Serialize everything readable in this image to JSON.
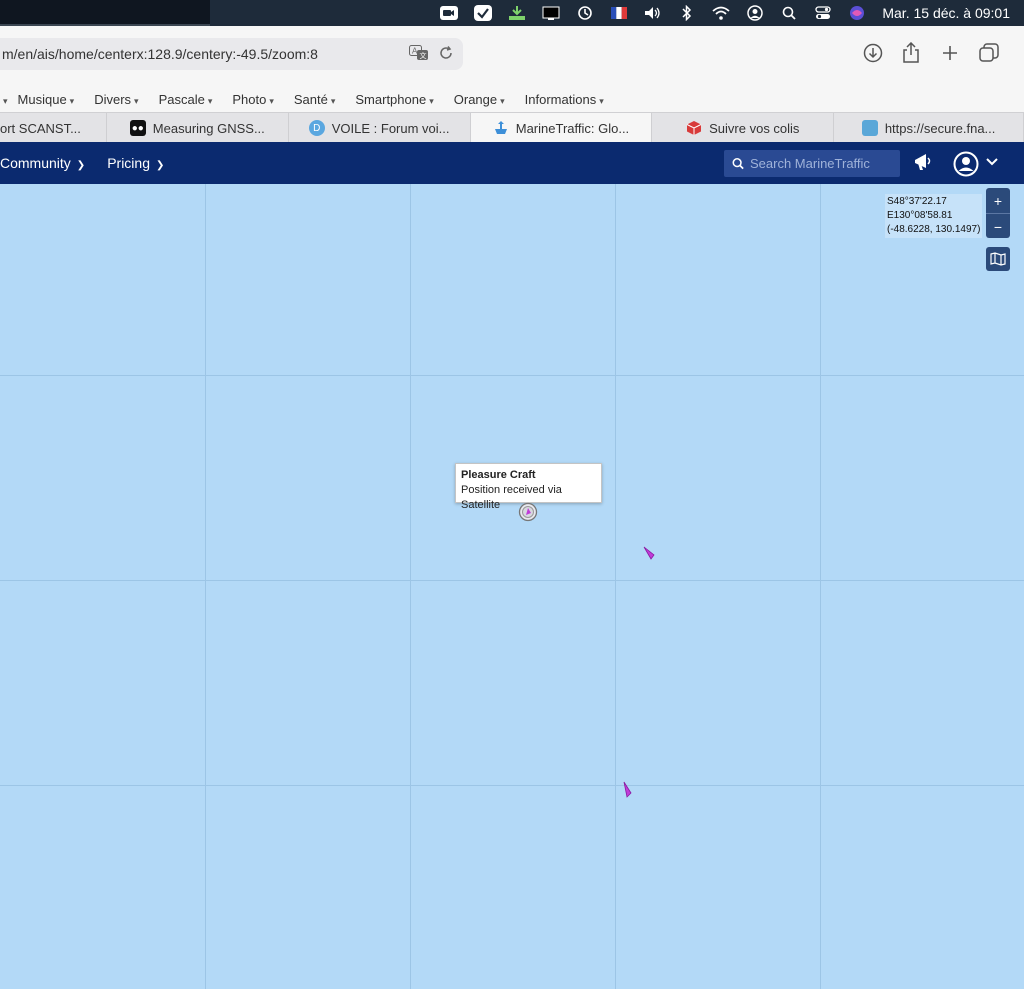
{
  "menubar": {
    "icons": [
      "video-icon",
      "check-icon",
      "download-icon",
      "display-icon",
      "time-machine-icon",
      "flag-fr-icon",
      "volume-icon",
      "bluetooth-icon",
      "wifi-icon",
      "user-icon",
      "search-icon",
      "control-center-icon",
      "siri-icon"
    ],
    "clock": "Mar. 15 déc. à  09:01"
  },
  "browser": {
    "url": "m/en/ais/home/centerx:128.9/centery:-49.5/zoom:8",
    "bookmarks": [
      "Musique",
      "Divers",
      "Pascale",
      "Photo",
      "Santé",
      "Smartphone",
      "Orange",
      "Informations"
    ],
    "tabs": [
      {
        "label": "ort SCANST...",
        "favicon": "none"
      },
      {
        "label": "Measuring GNSS...",
        "favicon": "medium-icon"
      },
      {
        "label": "VOILE : Forum voi...",
        "favicon": "forum-icon"
      },
      {
        "label": "MarineTraffic: Glo...",
        "favicon": "marinetraffic-icon"
      },
      {
        "label": "Suivre vos colis",
        "favicon": "package-icon"
      },
      {
        "label": "https://secure.fna...",
        "favicon": "fnac-icon"
      }
    ]
  },
  "mtnav": {
    "items": [
      "Community",
      "Pricing"
    ],
    "search_placeholder": "Search MarineTraffic"
  },
  "map": {
    "coords_dms_lat": "S48°37'22.17",
    "coords_dms_lon": "E130°08'58.81",
    "coords_decimal": "(-48.6228, 130.1497)",
    "zoom_in": "+",
    "zoom_out": "−",
    "tooltip_title": "Pleasure Craft",
    "tooltip_subtitle": "Position received via Satellite",
    "vessel_color": "#c03cd8",
    "sea_color": "#b3d9f7"
  }
}
